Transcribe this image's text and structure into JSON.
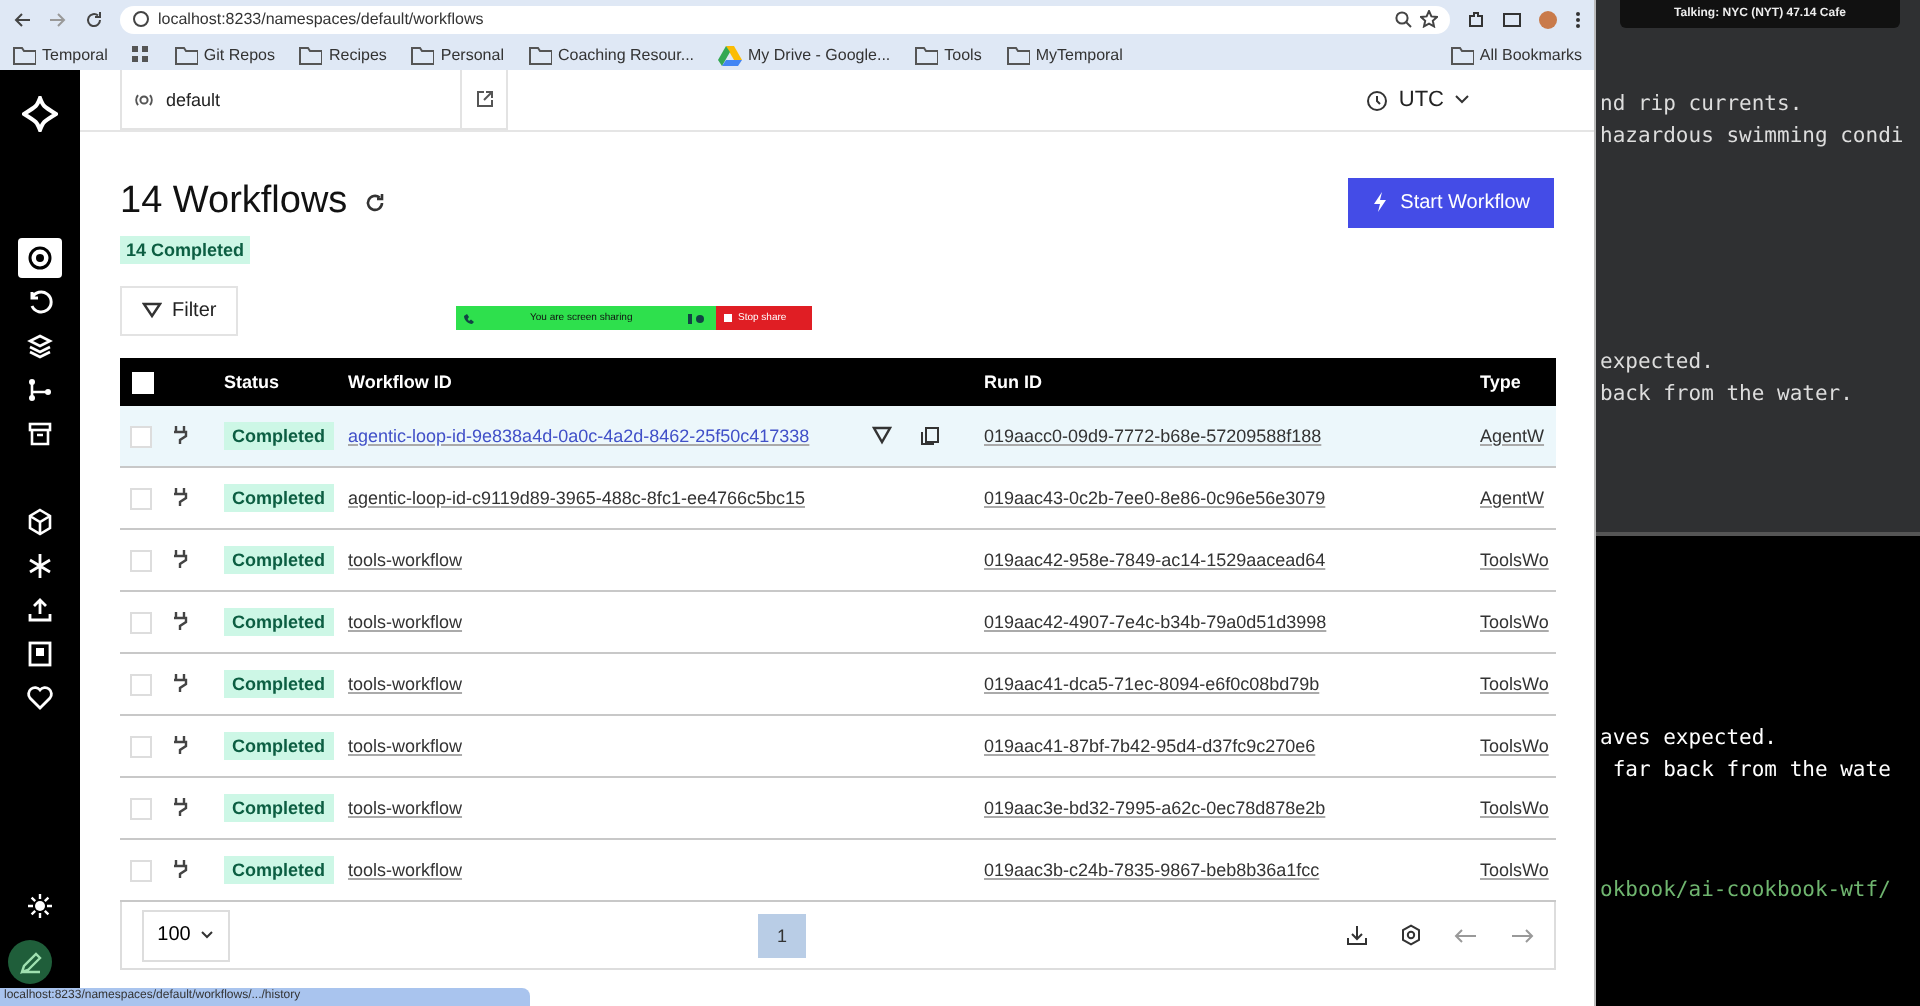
{
  "browser": {
    "url": "localhost:8233/namespaces/default/workflows",
    "bookmarks": [
      {
        "label": "Temporal",
        "kind": "folder"
      },
      {
        "label": "Git Repos",
        "kind": "folder"
      },
      {
        "label": "Recipes",
        "kind": "folder"
      },
      {
        "label": "Personal",
        "kind": "folder"
      },
      {
        "label": "Coaching Resour...",
        "kind": "folder"
      },
      {
        "label": "My Drive - Google...",
        "kind": "drive"
      },
      {
        "label": "Tools",
        "kind": "folder"
      },
      {
        "label": "MyTemporal",
        "kind": "folder"
      }
    ],
    "all_bookmarks": "All Bookmarks",
    "status_url": "localhost:8233/namespaces/default/workflows/.../history"
  },
  "sidebar": {
    "items": [
      {
        "selected": true
      },
      {
        "selected": false
      },
      {
        "selected": false
      },
      {
        "selected": false
      },
      {
        "selected": false
      }
    ]
  },
  "header": {
    "namespace": "default",
    "timezone": "UTC"
  },
  "title": "14 Workflows",
  "summary_badge": "14 Completed",
  "start_button": "Start Workflow",
  "filter_button": "Filter",
  "share_banner": {
    "message": "You are screen sharing",
    "stop": "Stop share"
  },
  "table": {
    "select_all_checked": false,
    "columns": [
      "Status",
      "Workflow ID",
      "Run ID",
      "Type"
    ],
    "rows": [
      {
        "status": "Completed",
        "workflow_id": "agentic-loop-id-9e838a4d-0a0c-4a2d-8462-25f50c417338",
        "run_id": "019aacc0-09d9-7772-b68e-57209588f188",
        "type": "AgentW",
        "highlighted": true,
        "checked": false
      },
      {
        "status": "Completed",
        "workflow_id": "agentic-loop-id-c9119d89-3965-488c-8fc1-ee4766c5bc15",
        "run_id": "019aac43-0c2b-7ee0-8e86-0c96e56e3079",
        "type": "AgentW",
        "highlighted": false,
        "checked": false
      },
      {
        "status": "Completed",
        "workflow_id": "tools-workflow",
        "run_id": "019aac42-958e-7849-ac14-1529aacead64",
        "type": "ToolsWo",
        "highlighted": false,
        "checked": false
      },
      {
        "status": "Completed",
        "workflow_id": "tools-workflow",
        "run_id": "019aac42-4907-7e4c-b34b-79a0d51d3998",
        "type": "ToolsWo",
        "highlighted": false,
        "checked": false
      },
      {
        "status": "Completed",
        "workflow_id": "tools-workflow",
        "run_id": "019aac41-dca5-71ec-8094-e6f0c08bd79b",
        "type": "ToolsWo",
        "highlighted": false,
        "checked": false
      },
      {
        "status": "Completed",
        "workflow_id": "tools-workflow",
        "run_id": "019aac41-87bf-7b42-95d4-d37fc9c270e6",
        "type": "ToolsWo",
        "highlighted": false,
        "checked": false
      },
      {
        "status": "Completed",
        "workflow_id": "tools-workflow",
        "run_id": "019aac3e-bd32-7995-a62c-0ec78d878e2b",
        "type": "ToolsWo",
        "highlighted": false,
        "checked": false
      },
      {
        "status": "Completed",
        "workflow_id": "tools-workflow",
        "run_id": "019aac3b-c24b-7835-9867-beb8b36a1fcc",
        "type": "ToolsWo",
        "highlighted": false,
        "checked": false
      }
    ]
  },
  "pagination": {
    "page_size": "100",
    "page": "1"
  },
  "terminal_top": {
    "caption": "Talking: NYC (NYT) 47.14 Cafe",
    "blocks": [
      [
        "nd rip currents.",
        "hazardous swimming condi"
      ],
      [
        "expected.",
        "back from the water."
      ]
    ]
  },
  "terminal_bottom": {
    "blocks": [
      [
        "aves expected.",
        " far back from the wate"
      ]
    ],
    "link": "okbook/ai-cookbook-wtf/"
  }
}
